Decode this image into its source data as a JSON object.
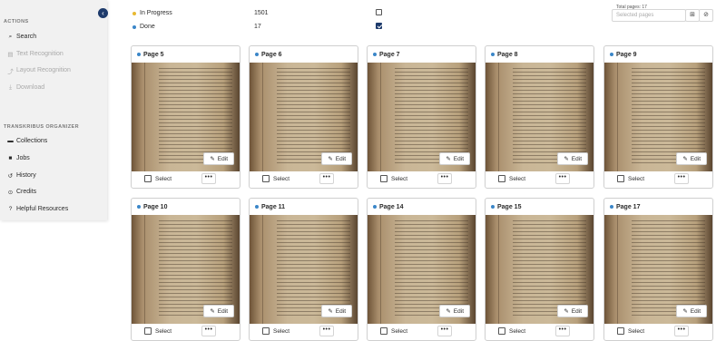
{
  "sidebar": {
    "actions_label": "ACTIONS",
    "actions": [
      {
        "label": "Search",
        "icon": "search-icon",
        "disabled": false
      },
      {
        "label": "Text Recognition",
        "icon": "text-recognition-icon",
        "disabled": true
      },
      {
        "label": "Layout Recognition",
        "icon": "layout-recognition-icon",
        "disabled": true
      },
      {
        "label": "Download",
        "icon": "download-icon",
        "disabled": true
      }
    ],
    "organizer_label": "TRANSKRIBUS ORGANIZER",
    "organizer": [
      {
        "label": "Collections",
        "icon": "folder-icon"
      },
      {
        "label": "Jobs",
        "icon": "jobs-icon"
      },
      {
        "label": "History",
        "icon": "history-icon"
      },
      {
        "label": "Credits",
        "icon": "credits-icon"
      },
      {
        "label": "Helpful Resources",
        "icon": "help-icon"
      }
    ]
  },
  "status_legend": [
    {
      "label": "In Progress",
      "count": "1501",
      "color": "#e8b931",
      "checked": false
    },
    {
      "label": "Done",
      "count": "17",
      "color": "#3a86c8",
      "checked": true
    }
  ],
  "page_selector": {
    "total_label": "Total pages: 17",
    "placeholder": "Selected pages"
  },
  "cards": [
    {
      "title": "Page 5",
      "edit": "Edit",
      "select": "Select",
      "more": "•••"
    },
    {
      "title": "Page 6",
      "edit": "Edit",
      "select": "Select",
      "more": "•••"
    },
    {
      "title": "Page 7",
      "edit": "Edit",
      "select": "Select",
      "more": "•••"
    },
    {
      "title": "Page 8",
      "edit": "Edit",
      "select": "Select",
      "more": "•••"
    },
    {
      "title": "Page 9",
      "edit": "Edit",
      "select": "Select",
      "more": "•••"
    },
    {
      "title": "Page 10",
      "edit": "Edit",
      "select": "Select",
      "more": "•••"
    },
    {
      "title": "Page 11",
      "edit": "Edit",
      "select": "Select",
      "more": "•••"
    },
    {
      "title": "Page 14",
      "edit": "Edit",
      "select": "Select",
      "more": "•••"
    },
    {
      "title": "Page 15",
      "edit": "Edit",
      "select": "Select",
      "more": "•••"
    },
    {
      "title": "Page 17",
      "edit": "Edit",
      "select": "Select",
      "more": "•••"
    }
  ],
  "colors": {
    "accent": "#1d3a6b",
    "done_dot": "#3a86c8",
    "progress_dot": "#e8b931"
  }
}
